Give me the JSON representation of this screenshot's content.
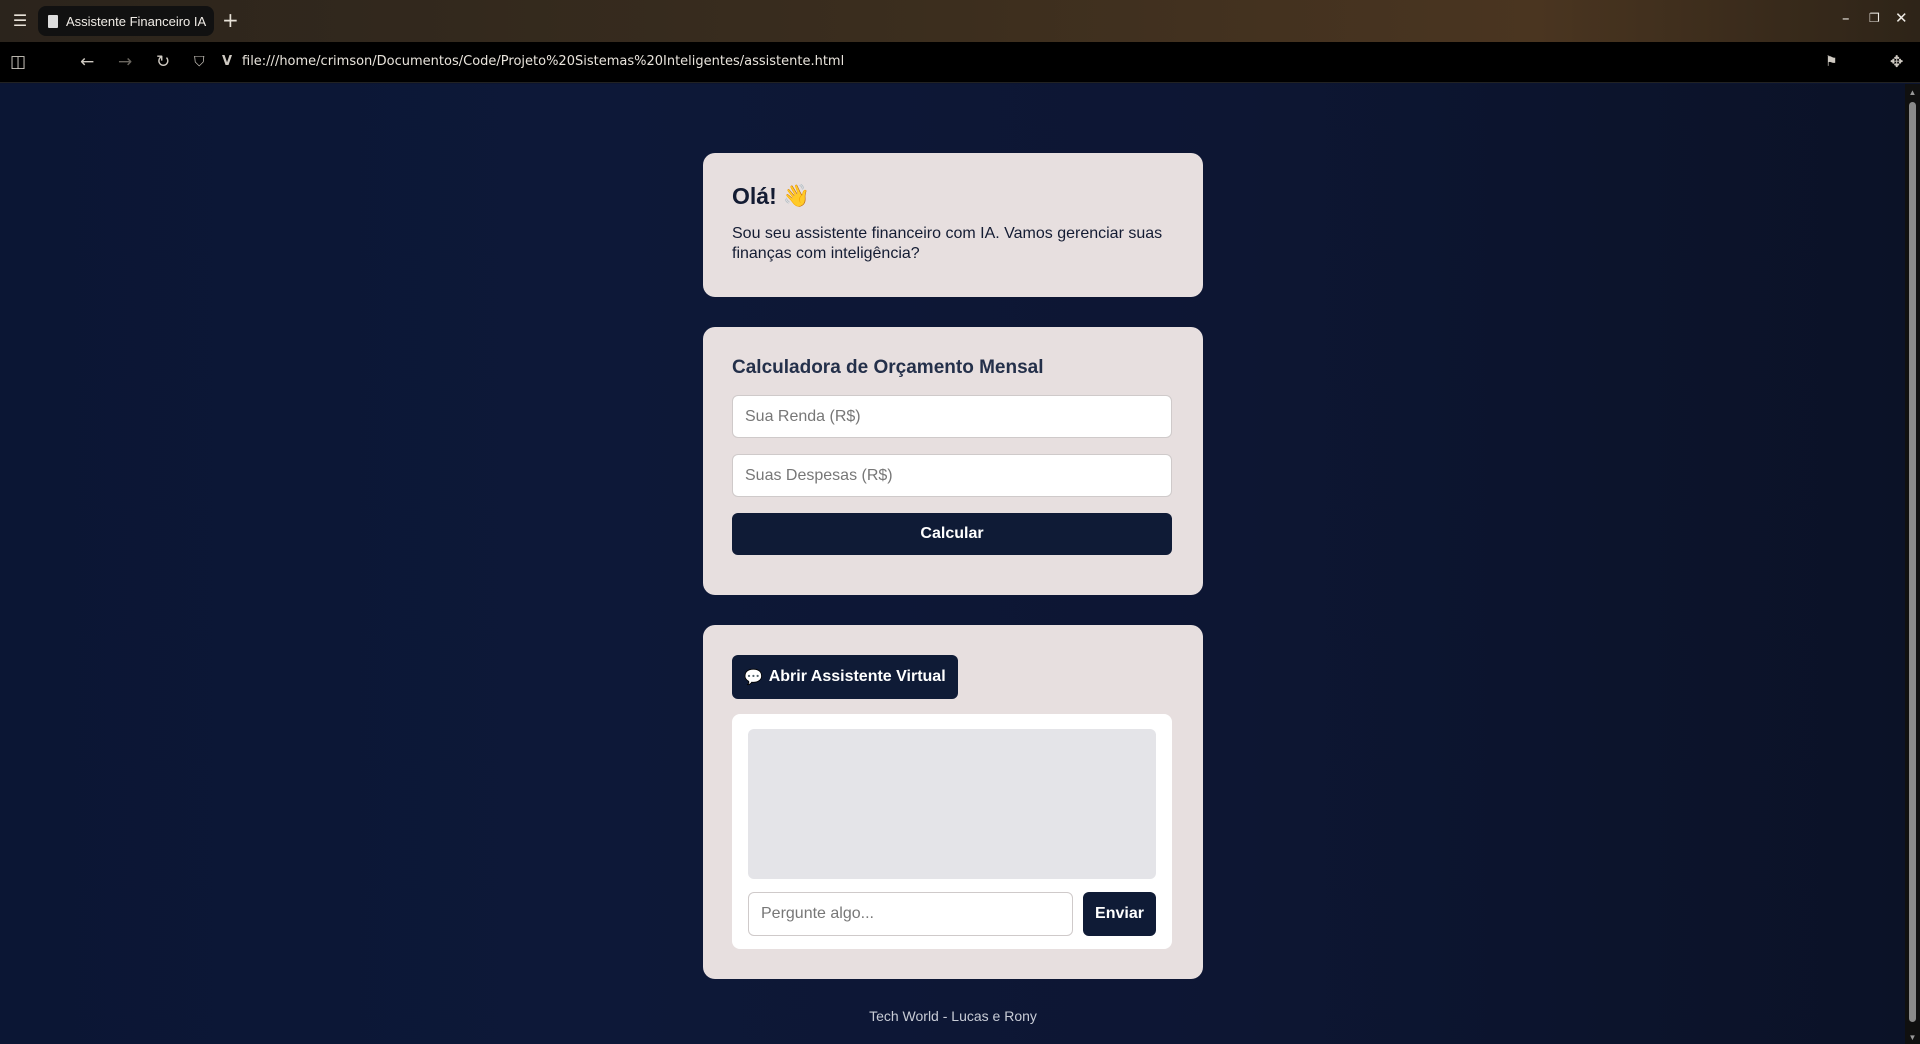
{
  "browser": {
    "tab_title": "Assistente Financeiro IA",
    "new_tab": "+",
    "url": "file:///home/crimson/Documentos/Code/Projeto%20Sistemas%20Inteligentes/assistente.html",
    "icons": [
      "menu-icon",
      "sidebar-icon",
      "back-icon",
      "forward-icon",
      "reload-icon",
      "shield-icon",
      "bookmark-icon",
      "extensions-icon",
      "minimize-icon",
      "maximize-icon",
      "close-icon"
    ]
  },
  "greeting": {
    "title": "Olá!",
    "emoji": "👋",
    "text": "Sou seu assistente financeiro com IA. Vamos gerenciar suas finanças com inteligência?"
  },
  "calculator": {
    "title": "Calculadora de Orçamento Mensal",
    "income_placeholder": "Sua Renda (R$)",
    "expenses_placeholder": "Suas Despesas (R$)",
    "button": "Calcular"
  },
  "assistant": {
    "open_button": "Abrir Assistente Virtual",
    "open_icon": "💬",
    "input_placeholder": "Pergunte algo...",
    "send_button": "Enviar"
  },
  "footer": {
    "text": "Tech World - Lucas e Rony"
  },
  "colors": {
    "background": "#0c1530",
    "card": "#e7dfdf",
    "primary": "#0f1b36"
  }
}
